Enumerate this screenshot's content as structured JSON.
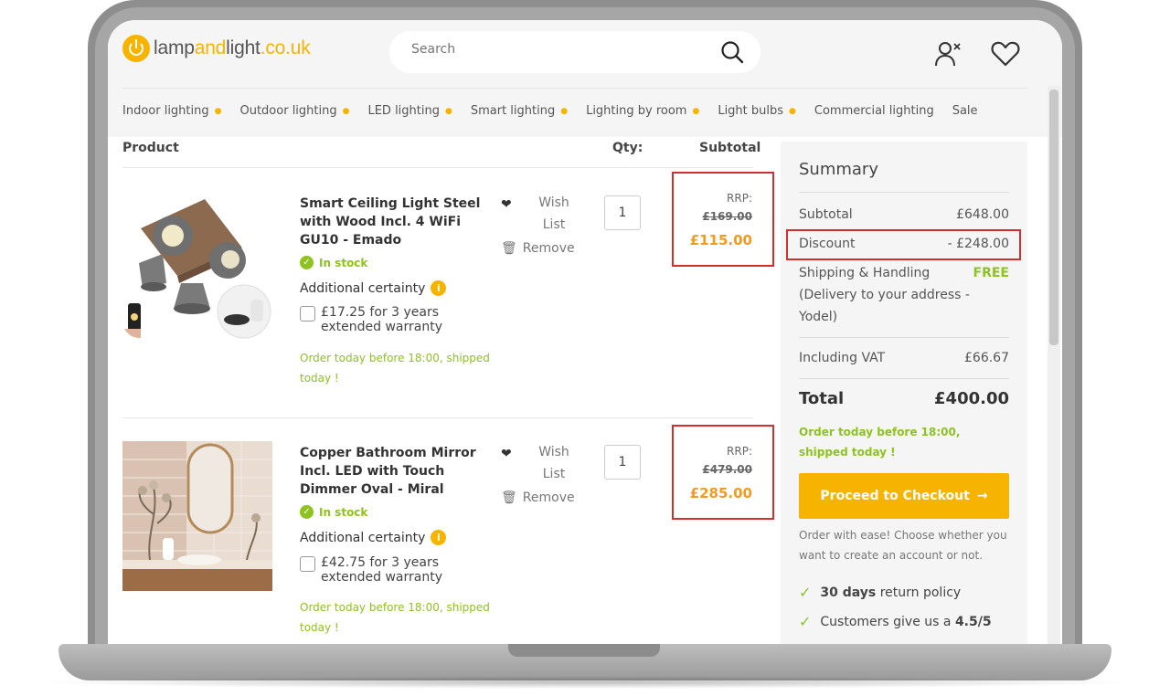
{
  "header": {
    "logo": {
      "part1": "lamp",
      "part2": "and",
      "part3": "light",
      "part4": ".co.uk"
    },
    "search_placeholder": "Search"
  },
  "nav": {
    "items": [
      {
        "label": "Indoor lighting",
        "has_caret": true
      },
      {
        "label": "Outdoor lighting",
        "has_caret": true
      },
      {
        "label": "LED lighting",
        "has_caret": true
      },
      {
        "label": "Smart lighting",
        "has_caret": true
      },
      {
        "label": "Lighting by room",
        "has_caret": true
      },
      {
        "label": "Light bulbs",
        "has_caret": true
      },
      {
        "label": "Commercial lighting",
        "has_caret": false
      },
      {
        "label": "Sale",
        "has_caret": false
      }
    ]
  },
  "cart": {
    "columns": {
      "product": "Product",
      "qty": "Qty:",
      "subtotal": "Subtotal"
    },
    "items": [
      {
        "title": "Smart Ceiling Light Steel with Wood Incl. 4 WiFi GU10 - Emado",
        "stock": "In stock",
        "certainty_label": "Additional certainty",
        "warranty": "£17.25 for 3 years extended warranty",
        "ship_note": "Order today before 18:00, shipped today !",
        "wish_label": "Wish List",
        "remove_label": "Remove",
        "qty": "1",
        "rrp_label": "RRP:",
        "rrp": "£169.00",
        "price": "£115.00"
      },
      {
        "title": "Copper Bathroom Mirror Incl. LED with Touch Dimmer Oval - Miral",
        "stock": "In stock",
        "certainty_label": "Additional certainty",
        "warranty": "£42.75 for 3 years extended warranty",
        "ship_note": "Order today before 18:00, shipped today !",
        "wish_label": "Wish List",
        "remove_label": "Remove",
        "qty": "1",
        "rrp_label": "RRP:",
        "rrp": "£479.00",
        "price": "£285.00"
      }
    ]
  },
  "summary": {
    "title": "Summary",
    "subtotal_label": "Subtotal",
    "subtotal_value": "£648.00",
    "discount_label": "Discount",
    "discount_value": "- £248.00",
    "shipping_label": "Shipping & Handling",
    "shipping_value": "FREE",
    "shipping_detail": "(Delivery to your address - Yodel)",
    "vat_label": "Including VAT",
    "vat_value": "£66.67",
    "total_label": "Total",
    "total_value": "£400.00",
    "ship_note": "Order today before 18:00, shipped today !",
    "checkout_label": "Proceed to Checkout",
    "ease_note": "Order with ease! Choose whether you want to create an account or not.",
    "perk1_bold": "30 days",
    "perk1_text": "return policy",
    "perk2_text": "Customers give us a",
    "perk2_bold": "4.5/5"
  },
  "colors": {
    "brand": "#f6b400",
    "success": "#8dc21f",
    "sale": "#f39a1e",
    "highlight": "#d32f2f"
  }
}
